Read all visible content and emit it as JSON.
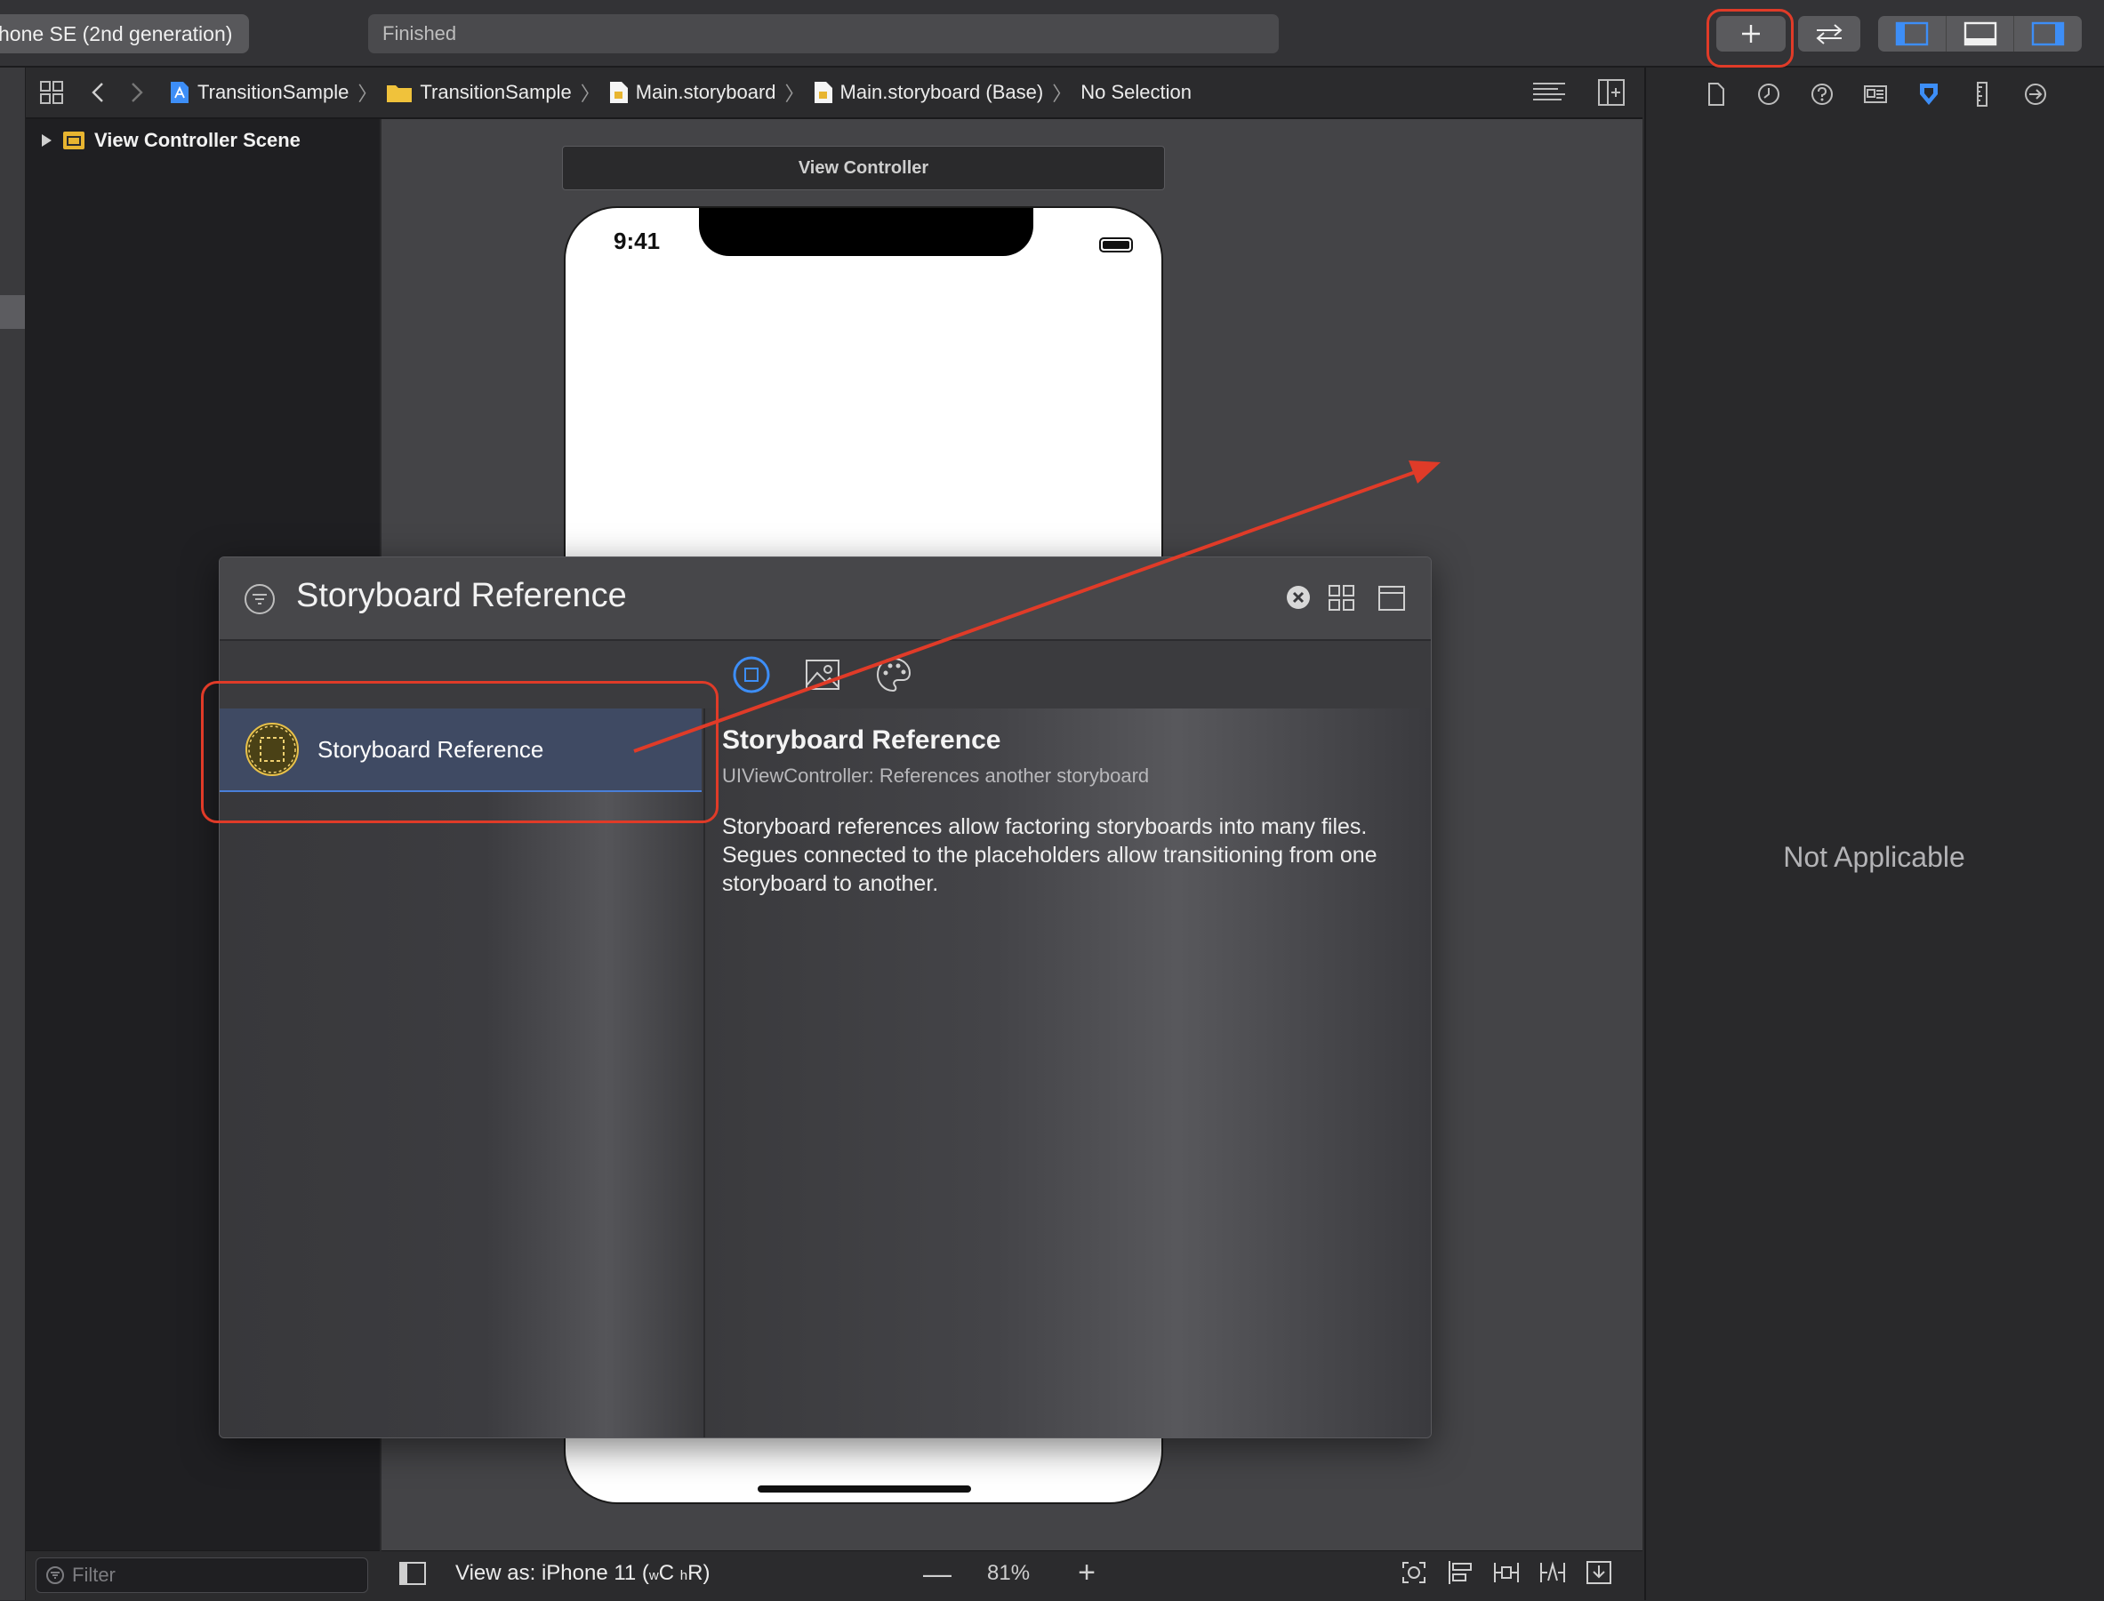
{
  "toolbar": {
    "scheme": "hone SE (2nd generation)",
    "activity_status": "Finished"
  },
  "jumpbar": {
    "crumbs": [
      "TransitionSample",
      "TransitionSample",
      "Main.storyboard",
      "Main.storyboard (Base)",
      "No Selection"
    ]
  },
  "navigator": {
    "scene_label": "View Controller Scene",
    "filter_placeholder": "Filter"
  },
  "canvas": {
    "vc_label": "View Controller",
    "clock": "9:41",
    "view_as_prefix": "View as: iPhone 11 (",
    "size_w": "w",
    "size_c": "C",
    "size_h": "h",
    "size_r": "R)",
    "zoom_minus": "—",
    "zoom": "81%",
    "zoom_plus": "+"
  },
  "library": {
    "search_text": "Storyboard Reference",
    "item_label": "Storyboard Reference",
    "detail_title": "Storyboard Reference",
    "detail_subtitle": "UIViewController: References another storyboard",
    "detail_description": "Storyboard references allow factoring storyboards into many files. Segues connected to the placeholders allow transitioning from one storyboard to another."
  },
  "inspector": {
    "empty_message": "Not Applicable"
  },
  "colors": {
    "annotation_red": "#e03b28",
    "accent_blue": "#3d8ef7"
  }
}
